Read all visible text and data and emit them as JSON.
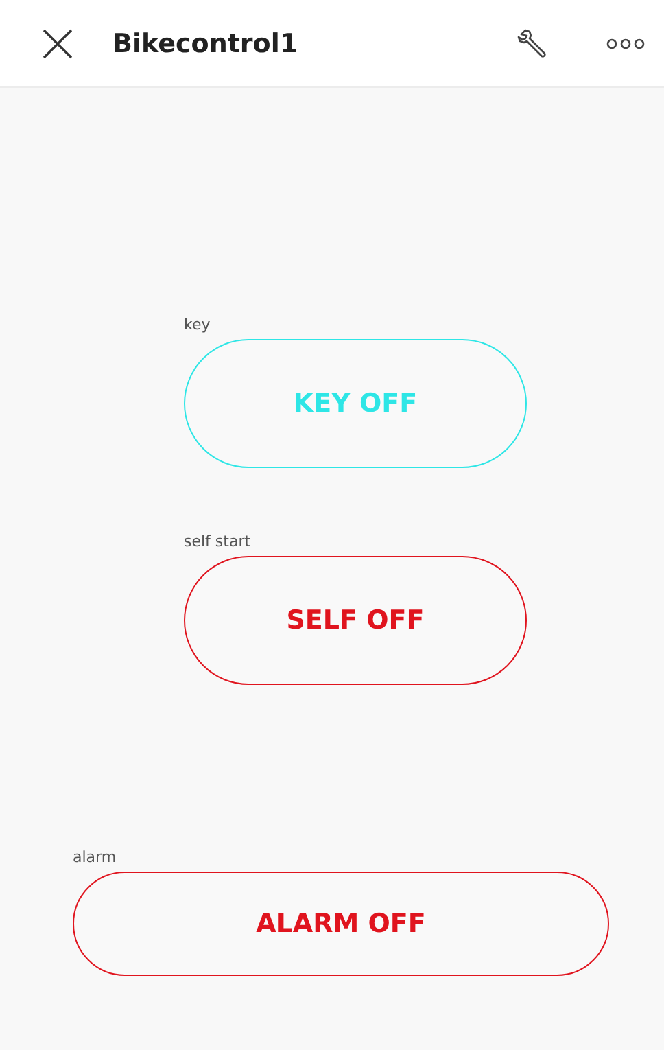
{
  "header": {
    "title": "Bikecontrol1"
  },
  "widgets": [
    {
      "label": "key",
      "text": "KEY OFF",
      "color": "#2ee6e6"
    },
    {
      "label": "self start",
      "text": "SELF OFF",
      "color": "#e0141e"
    },
    {
      "label": "alarm",
      "text": "ALARM OFF",
      "color": "#e0141e"
    }
  ]
}
